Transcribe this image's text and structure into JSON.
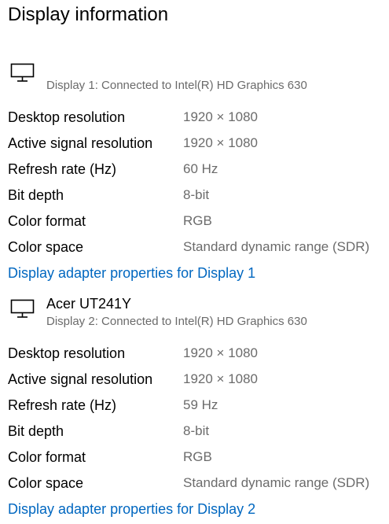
{
  "page": {
    "title": "Display information"
  },
  "displays": [
    {
      "name": "",
      "icon": "monitor-icon",
      "subtitle": "Display 1: Connected to Intel(R) HD Graphics 630",
      "rows": [
        {
          "label": "Desktop resolution",
          "value": "1920 × 1080"
        },
        {
          "label": "Active signal resolution",
          "value": "1920 × 1080"
        },
        {
          "label": "Refresh rate (Hz)",
          "value": "60 Hz"
        },
        {
          "label": "Bit depth",
          "value": "8-bit"
        },
        {
          "label": "Color format",
          "value": "RGB"
        },
        {
          "label": "Color space",
          "value": "Standard dynamic range (SDR)"
        }
      ],
      "link_label": "Display adapter properties for Display 1"
    },
    {
      "name": "Acer UT241Y",
      "icon": "monitor-icon",
      "subtitle": "Display 2: Connected to Intel(R) HD Graphics 630",
      "rows": [
        {
          "label": "Desktop resolution",
          "value": "1920 × 1080"
        },
        {
          "label": "Active signal resolution",
          "value": "1920 × 1080"
        },
        {
          "label": "Refresh rate (Hz)",
          "value": "59 Hz"
        },
        {
          "label": "Bit depth",
          "value": "8-bit"
        },
        {
          "label": "Color format",
          "value": "RGB"
        },
        {
          "label": "Color space",
          "value": "Standard dynamic range (SDR)"
        }
      ],
      "link_label": "Display adapter properties for Display 2"
    }
  ],
  "colors": {
    "link": "#0067c0",
    "secondary_text": "#6b6b6b",
    "text": "#000000",
    "background": "#ffffff"
  }
}
